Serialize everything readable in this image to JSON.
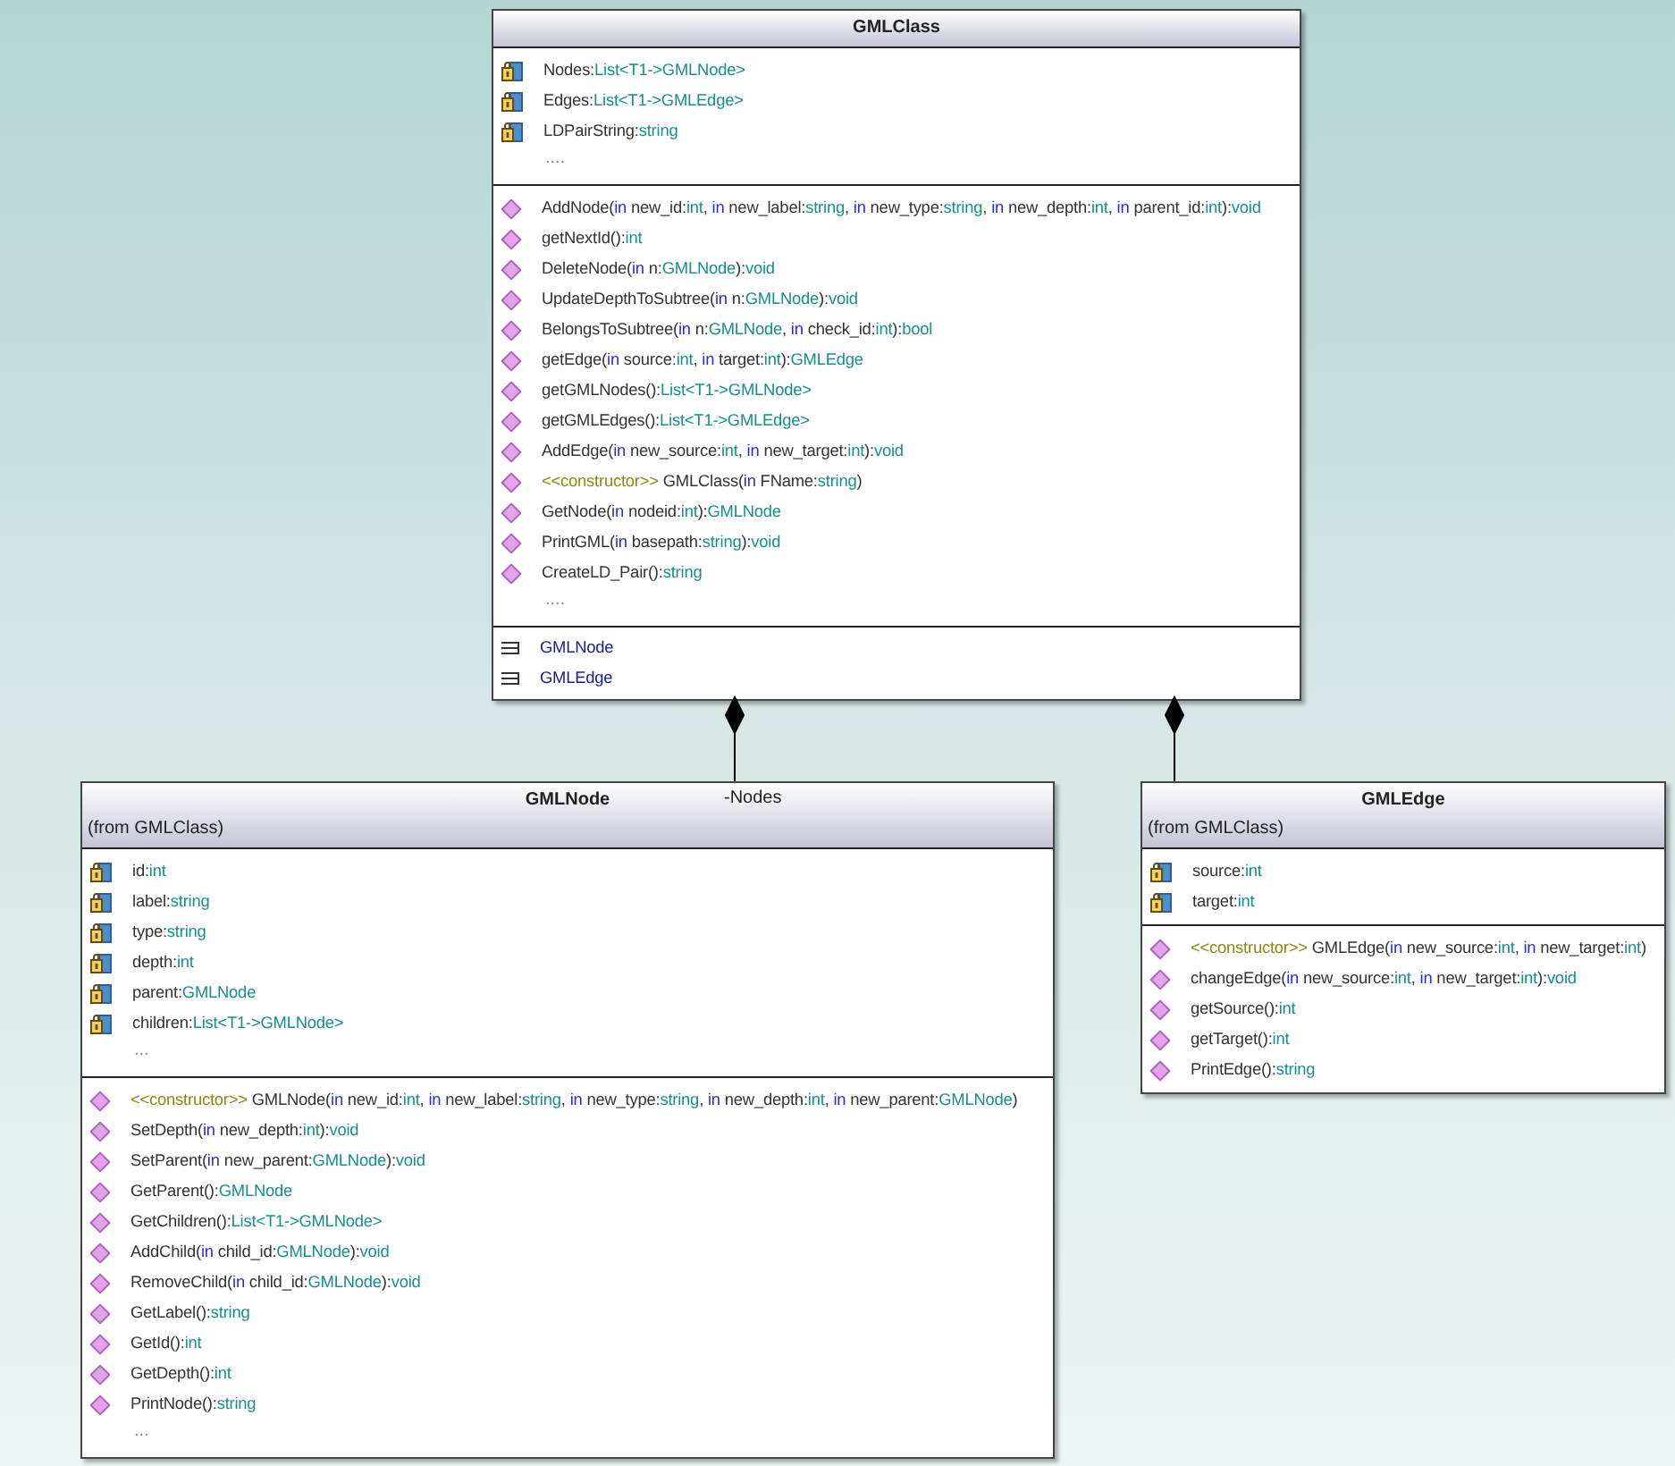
{
  "classes": [
    {
      "name": "GMLClass",
      "attributes": [
        [
          {
            "kind": "plain",
            "text": "Nodes:"
          },
          {
            "kind": "type",
            "text": "List<T1->GMLNode>"
          }
        ],
        [
          {
            "kind": "plain",
            "text": "Edges:"
          },
          {
            "kind": "type",
            "text": "List<T1->GMLEdge>"
          }
        ],
        [
          {
            "kind": "plain",
            "text": "LDPairString:"
          },
          {
            "kind": "type",
            "text": "string"
          }
        ]
      ],
      "attributes_more": "....",
      "methods": [
        [
          {
            "kind": "plain",
            "text": "AddNode("
          },
          {
            "kind": "kw",
            "text": "in"
          },
          {
            "kind": "plain",
            "text": " new_id:"
          },
          {
            "kind": "type",
            "text": "int"
          },
          {
            "kind": "plain",
            "text": ", "
          },
          {
            "kind": "kw",
            "text": "in"
          },
          {
            "kind": "plain",
            "text": " new_label:"
          },
          {
            "kind": "type",
            "text": "string"
          },
          {
            "kind": "plain",
            "text": ", "
          },
          {
            "kind": "kw",
            "text": "in"
          },
          {
            "kind": "plain",
            "text": " new_type:"
          },
          {
            "kind": "type",
            "text": "string"
          },
          {
            "kind": "plain",
            "text": ", "
          },
          {
            "kind": "kw",
            "text": "in"
          },
          {
            "kind": "plain",
            "text": " new_depth:"
          },
          {
            "kind": "type",
            "text": "int"
          },
          {
            "kind": "plain",
            "text": ", "
          },
          {
            "kind": "kw",
            "text": "in"
          },
          {
            "kind": "plain",
            "text": " parent_id:"
          },
          {
            "kind": "type",
            "text": "int"
          },
          {
            "kind": "plain",
            "text": "):"
          },
          {
            "kind": "type",
            "text": "void"
          }
        ],
        [
          {
            "kind": "plain",
            "text": "getNextId():"
          },
          {
            "kind": "type",
            "text": "int"
          }
        ],
        [
          {
            "kind": "plain",
            "text": "DeleteNode("
          },
          {
            "kind": "kw",
            "text": "in"
          },
          {
            "kind": "plain",
            "text": " n:"
          },
          {
            "kind": "type",
            "text": "GMLNode"
          },
          {
            "kind": "plain",
            "text": "):"
          },
          {
            "kind": "type",
            "text": "void"
          }
        ],
        [
          {
            "kind": "plain",
            "text": "UpdateDepthToSubtree("
          },
          {
            "kind": "kw",
            "text": "in"
          },
          {
            "kind": "plain",
            "text": " n:"
          },
          {
            "kind": "type",
            "text": "GMLNode"
          },
          {
            "kind": "plain",
            "text": "):"
          },
          {
            "kind": "type",
            "text": "void"
          }
        ],
        [
          {
            "kind": "plain",
            "text": "BelongsToSubtree("
          },
          {
            "kind": "kw",
            "text": "in"
          },
          {
            "kind": "plain",
            "text": " n:"
          },
          {
            "kind": "type",
            "text": "GMLNode"
          },
          {
            "kind": "plain",
            "text": ", "
          },
          {
            "kind": "kw",
            "text": "in"
          },
          {
            "kind": "plain",
            "text": " check_id:"
          },
          {
            "kind": "type",
            "text": "int"
          },
          {
            "kind": "plain",
            "text": "):"
          },
          {
            "kind": "type",
            "text": "bool"
          }
        ],
        [
          {
            "kind": "plain",
            "text": "getEdge("
          },
          {
            "kind": "kw",
            "text": "in"
          },
          {
            "kind": "plain",
            "text": " source:"
          },
          {
            "kind": "type",
            "text": "int"
          },
          {
            "kind": "plain",
            "text": ", "
          },
          {
            "kind": "kw",
            "text": "in"
          },
          {
            "kind": "plain",
            "text": " target:"
          },
          {
            "kind": "type",
            "text": "int"
          },
          {
            "kind": "plain",
            "text": "):"
          },
          {
            "kind": "type",
            "text": "GMLEdge"
          }
        ],
        [
          {
            "kind": "plain",
            "text": "getGMLNodes():"
          },
          {
            "kind": "type",
            "text": "List<T1->GMLNode>"
          }
        ],
        [
          {
            "kind": "plain",
            "text": "getGMLEdges():"
          },
          {
            "kind": "type",
            "text": "List<T1->GMLEdge>"
          }
        ],
        [
          {
            "kind": "plain",
            "text": "AddEdge("
          },
          {
            "kind": "kw",
            "text": "in"
          },
          {
            "kind": "plain",
            "text": " new_source:"
          },
          {
            "kind": "type",
            "text": "int"
          },
          {
            "kind": "plain",
            "text": ", "
          },
          {
            "kind": "kw",
            "text": "in"
          },
          {
            "kind": "plain",
            "text": " new_target:"
          },
          {
            "kind": "type",
            "text": "int"
          },
          {
            "kind": "plain",
            "text": "):"
          },
          {
            "kind": "type",
            "text": "void"
          }
        ],
        [
          {
            "kind": "stereo",
            "text": "<<constructor>>"
          },
          {
            "kind": "plain",
            "text": " GMLClass("
          },
          {
            "kind": "kw",
            "text": "in"
          },
          {
            "kind": "plain",
            "text": " FName:"
          },
          {
            "kind": "type",
            "text": "string"
          },
          {
            "kind": "plain",
            "text": ")"
          }
        ],
        [
          {
            "kind": "plain",
            "text": "GetNode("
          },
          {
            "kind": "kw",
            "text": "in"
          },
          {
            "kind": "plain",
            "text": " nodeid:"
          },
          {
            "kind": "type",
            "text": "int"
          },
          {
            "kind": "plain",
            "text": "):"
          },
          {
            "kind": "type",
            "text": "GMLNode"
          }
        ],
        [
          {
            "kind": "plain",
            "text": "PrintGML("
          },
          {
            "kind": "kw",
            "text": "in"
          },
          {
            "kind": "plain",
            "text": " basepath:"
          },
          {
            "kind": "type",
            "text": "string"
          },
          {
            "kind": "plain",
            "text": "):"
          },
          {
            "kind": "type",
            "text": "void"
          }
        ],
        [
          {
            "kind": "plain",
            "text": "CreateLD_Pair():"
          },
          {
            "kind": "type",
            "text": "string"
          }
        ]
      ],
      "methods_more": "....",
      "nested": [
        "GMLNode",
        "GMLEdge"
      ]
    },
    {
      "name": "GMLNode",
      "from": "(from GMLClass)",
      "attributes": [
        [
          {
            "kind": "plain",
            "text": "id:"
          },
          {
            "kind": "type",
            "text": "int"
          }
        ],
        [
          {
            "kind": "plain",
            "text": "label:"
          },
          {
            "kind": "type",
            "text": "string"
          }
        ],
        [
          {
            "kind": "plain",
            "text": "type:"
          },
          {
            "kind": "type",
            "text": "string"
          }
        ],
        [
          {
            "kind": "plain",
            "text": "depth:"
          },
          {
            "kind": "type",
            "text": "int"
          }
        ],
        [
          {
            "kind": "plain",
            "text": "parent:"
          },
          {
            "kind": "type",
            "text": "GMLNode"
          }
        ],
        [
          {
            "kind": "plain",
            "text": "children:"
          },
          {
            "kind": "type",
            "text": "List<T1->GMLNode>"
          }
        ]
      ],
      "attributes_more": "...",
      "methods": [
        [
          {
            "kind": "stereo",
            "text": "<<constructor>>"
          },
          {
            "kind": "plain",
            "text": " GMLNode("
          },
          {
            "kind": "kw",
            "text": "in"
          },
          {
            "kind": "plain",
            "text": " new_id:"
          },
          {
            "kind": "type",
            "text": "int"
          },
          {
            "kind": "plain",
            "text": ", "
          },
          {
            "kind": "kw",
            "text": "in"
          },
          {
            "kind": "plain",
            "text": " new_label:"
          },
          {
            "kind": "type",
            "text": "string"
          },
          {
            "kind": "plain",
            "text": ", "
          },
          {
            "kind": "kw",
            "text": "in"
          },
          {
            "kind": "plain",
            "text": " new_type:"
          },
          {
            "kind": "type",
            "text": "string"
          },
          {
            "kind": "plain",
            "text": ", "
          },
          {
            "kind": "kw",
            "text": "in"
          },
          {
            "kind": "plain",
            "text": " new_depth:"
          },
          {
            "kind": "type",
            "text": "int"
          },
          {
            "kind": "plain",
            "text": ", "
          },
          {
            "kind": "kw",
            "text": "in"
          },
          {
            "kind": "plain",
            "text": " new_parent:"
          },
          {
            "kind": "type",
            "text": "GMLNode"
          },
          {
            "kind": "plain",
            "text": ")"
          }
        ],
        [
          {
            "kind": "plain",
            "text": "SetDepth("
          },
          {
            "kind": "kw",
            "text": "in"
          },
          {
            "kind": "plain",
            "text": " new_depth:"
          },
          {
            "kind": "type",
            "text": "int"
          },
          {
            "kind": "plain",
            "text": "):"
          },
          {
            "kind": "type",
            "text": "void"
          }
        ],
        [
          {
            "kind": "plain",
            "text": "SetParent("
          },
          {
            "kind": "kw",
            "text": "in"
          },
          {
            "kind": "plain",
            "text": " new_parent:"
          },
          {
            "kind": "type",
            "text": "GMLNode"
          },
          {
            "kind": "plain",
            "text": "):"
          },
          {
            "kind": "type",
            "text": "void"
          }
        ],
        [
          {
            "kind": "plain",
            "text": "GetParent():"
          },
          {
            "kind": "type",
            "text": "GMLNode"
          }
        ],
        [
          {
            "kind": "plain",
            "text": "GetChildren():"
          },
          {
            "kind": "type",
            "text": "List<T1->GMLNode>"
          }
        ],
        [
          {
            "kind": "plain",
            "text": "AddChild("
          },
          {
            "kind": "kw",
            "text": "in"
          },
          {
            "kind": "plain",
            "text": " child_id:"
          },
          {
            "kind": "type",
            "text": "GMLNode"
          },
          {
            "kind": "plain",
            "text": "):"
          },
          {
            "kind": "type",
            "text": "void"
          }
        ],
        [
          {
            "kind": "plain",
            "text": "RemoveChild("
          },
          {
            "kind": "kw",
            "text": "in"
          },
          {
            "kind": "plain",
            "text": " child_id:"
          },
          {
            "kind": "type",
            "text": "GMLNode"
          },
          {
            "kind": "plain",
            "text": "):"
          },
          {
            "kind": "type",
            "text": "void"
          }
        ],
        [
          {
            "kind": "plain",
            "text": "GetLabel():"
          },
          {
            "kind": "type",
            "text": "string"
          }
        ],
        [
          {
            "kind": "plain",
            "text": "GetId():"
          },
          {
            "kind": "type",
            "text": "int"
          }
        ],
        [
          {
            "kind": "plain",
            "text": "GetDepth():"
          },
          {
            "kind": "type",
            "text": "int"
          }
        ],
        [
          {
            "kind": "plain",
            "text": "PrintNode():"
          },
          {
            "kind": "type",
            "text": "string"
          }
        ]
      ],
      "methods_more": "..."
    },
    {
      "name": "GMLEdge",
      "from": "(from GMLClass)",
      "attributes": [
        [
          {
            "kind": "plain",
            "text": "source:"
          },
          {
            "kind": "type",
            "text": "int"
          }
        ],
        [
          {
            "kind": "plain",
            "text": "target:"
          },
          {
            "kind": "type",
            "text": "int"
          }
        ]
      ],
      "methods": [
        [
          {
            "kind": "stereo",
            "text": "<<constructor>>"
          },
          {
            "kind": "plain",
            "text": " GMLEdge("
          },
          {
            "kind": "kw",
            "text": "in"
          },
          {
            "kind": "plain",
            "text": " new_source:"
          },
          {
            "kind": "type",
            "text": "int"
          },
          {
            "kind": "plain",
            "text": ", "
          },
          {
            "kind": "kw",
            "text": "in"
          },
          {
            "kind": "plain",
            "text": " new_target:"
          },
          {
            "kind": "type",
            "text": "int"
          },
          {
            "kind": "plain",
            "text": ")"
          }
        ],
        [
          {
            "kind": "plain",
            "text": "changeEdge("
          },
          {
            "kind": "kw",
            "text": "in"
          },
          {
            "kind": "plain",
            "text": " new_source:"
          },
          {
            "kind": "type",
            "text": "int"
          },
          {
            "kind": "plain",
            "text": ", "
          },
          {
            "kind": "kw",
            "text": "in"
          },
          {
            "kind": "plain",
            "text": " new_target:"
          },
          {
            "kind": "type",
            "text": "int"
          },
          {
            "kind": "plain",
            "text": "):"
          },
          {
            "kind": "type",
            "text": "void"
          }
        ],
        [
          {
            "kind": "plain",
            "text": "getSource():"
          },
          {
            "kind": "type",
            "text": "int"
          }
        ],
        [
          {
            "kind": "plain",
            "text": "getTarget():"
          },
          {
            "kind": "type",
            "text": "int"
          }
        ],
        [
          {
            "kind": "plain",
            "text": "PrintEdge():"
          },
          {
            "kind": "type",
            "text": "string"
          }
        ]
      ]
    }
  ],
  "relations": [
    {
      "kind": "composition",
      "label": "-Nodes"
    },
    {
      "kind": "composition"
    }
  ]
}
